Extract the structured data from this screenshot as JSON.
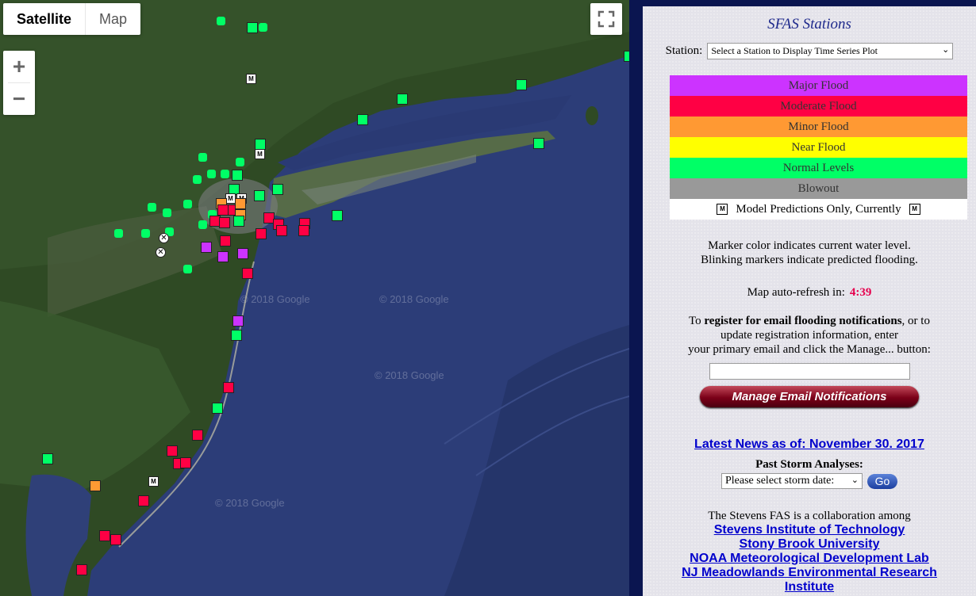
{
  "map": {
    "type_satellite": "Satellite",
    "type_map": "Map",
    "zoom_in": "+",
    "zoom_out": "−",
    "watermark": "© 2018 Google",
    "model_marker_letter": "M",
    "blowout_marker_letter": "✕"
  },
  "panel": {
    "title": "SFAS Stations",
    "station_label": "Station:",
    "station_select": "Select a Station to Display Time Series Plot",
    "legend": [
      {
        "label": "Major Flood",
        "color": "#cc33ff"
      },
      {
        "label": "Moderate Flood",
        "color": "#ff0044"
      },
      {
        "label": "Minor Flood",
        "color": "#ff9933"
      },
      {
        "label": "Near Flood",
        "color": "#ffff00"
      },
      {
        "label": "Normal Levels",
        "color": "#00ff66"
      },
      {
        "label": "Blowout",
        "color": "#999999"
      }
    ],
    "model_label": "Model Predictions Only, Currently",
    "info_line1": "Marker color indicates current water level.",
    "info_line2": "Blinking markers indicate predicted flooding.",
    "refresh_label": "Map auto-refresh in:",
    "refresh_count": "4:39",
    "register_pre": "To ",
    "register_bold": "register for email flooding notifications",
    "register_post": ", or to",
    "register_line2": "update registration information, enter",
    "register_line3": "your primary email and click the Manage... button:",
    "email_value": "",
    "manage_button": "Manage Email Notifications",
    "news_link": "Latest News as of: November 30. 2017",
    "storm_title": "Past Storm Analyses:",
    "storm_select": "Please select storm date:",
    "go_button": "Go",
    "collab_text": "The Stevens FAS is a collaboration among",
    "links": [
      "Stevens Institute of Technology",
      "Stony Brook University",
      "NOAA Meteorological Development Lab",
      "NJ Meadowlands Environmental Research",
      "Institute"
    ]
  },
  "colors": {
    "major": "#cc33ff",
    "moderate": "#ff0044",
    "minor": "#ff9933",
    "near": "#ffff00",
    "normal": "#00ff66",
    "blowout": "#999999"
  }
}
